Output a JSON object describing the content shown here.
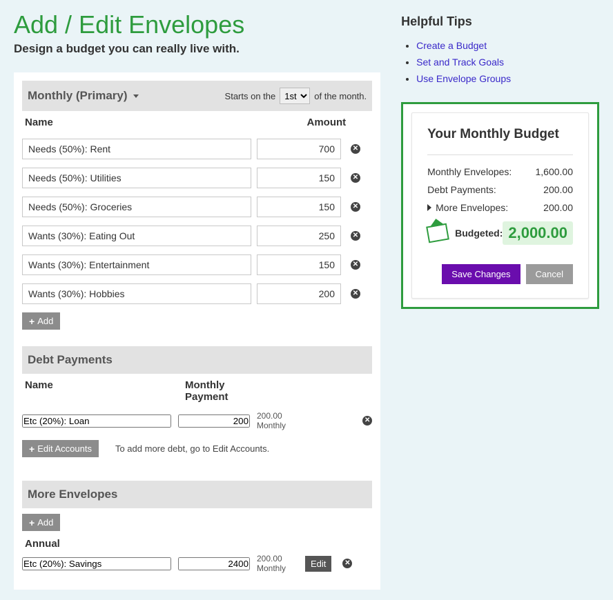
{
  "page": {
    "title": "Add / Edit Envelopes",
    "subtitle": "Design a budget you can really live with."
  },
  "monthly": {
    "label": "Monthly (Primary)",
    "starts_on_prefix": "Starts on the",
    "starts_on_suffix": "of the month.",
    "selected_day": "1st",
    "name_header": "Name",
    "amount_header": "Amount",
    "rows": [
      {
        "name": "Needs (50%): Rent",
        "amount": "700"
      },
      {
        "name": "Needs (50%): Utilities",
        "amount": "150"
      },
      {
        "name": "Needs (50%): Groceries",
        "amount": "150"
      },
      {
        "name": "Wants (30%): Eating Out",
        "amount": "250"
      },
      {
        "name": "Wants (30%): Entertainment",
        "amount": "150"
      },
      {
        "name": "Wants (30%): Hobbies",
        "amount": "200"
      }
    ],
    "add_label": "Add"
  },
  "debt": {
    "header": "Debt Payments",
    "name_header": "Name",
    "payment_header": "Monthly Payment",
    "rows": [
      {
        "name": "Etc (20%): Loan",
        "amount": "200",
        "calc_value": "200.00",
        "calc_unit": "Monthly"
      }
    ],
    "edit_accounts_label": "Edit Accounts",
    "tip": "To add more debt, go to Edit Accounts."
  },
  "more": {
    "header": "More Envelopes",
    "add_label": "Add",
    "sub_header": "Annual",
    "rows": [
      {
        "name": "Etc (20%): Savings",
        "amount": "2400",
        "calc_value": "200.00",
        "calc_unit": "Monthly",
        "edit_label": "Edit"
      }
    ]
  },
  "tips": {
    "header": "Helpful Tips",
    "links": [
      "Create a Budget",
      "Set and Track Goals",
      "Use Envelope Groups"
    ]
  },
  "budget": {
    "title": "Your Monthly Budget",
    "rows": [
      {
        "label": "Monthly Envelopes:",
        "value": "1,600.00"
      },
      {
        "label": "Debt Payments:",
        "value": "200.00"
      },
      {
        "label": "More Envelopes:",
        "value": "200.00",
        "expandable": true
      }
    ],
    "budgeted_label": "Budgeted:",
    "budgeted_value": "2,000.00",
    "save_label": "Save Changes",
    "cancel_label": "Cancel"
  }
}
